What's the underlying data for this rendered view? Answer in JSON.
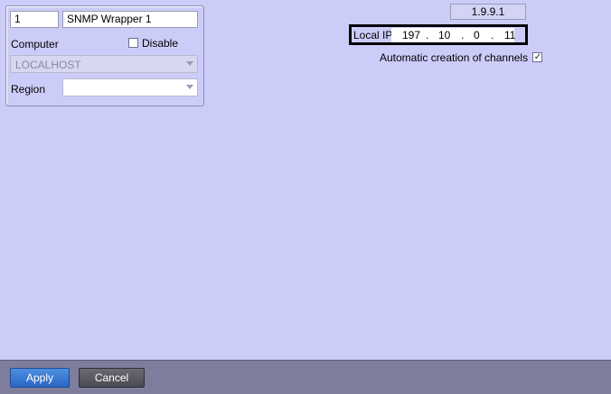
{
  "object": {
    "id": "1",
    "name": "SNMP Wrapper 1",
    "computer_label": "Computer",
    "disable_label": "Disable",
    "disable_checked": false,
    "computer_value": "LOCALHOST",
    "region_label": "Region",
    "region_value": ""
  },
  "version": "1.9.9.1",
  "local_ip": {
    "label": "Local IP",
    "octets": [
      "197",
      "10",
      "0",
      "11"
    ],
    "separator": "."
  },
  "auto_channels": {
    "label": "Automatic creation of channels",
    "checked": true,
    "check_glyph": "✓"
  },
  "footer": {
    "apply_label": "Apply",
    "cancel_label": "Cancel"
  }
}
